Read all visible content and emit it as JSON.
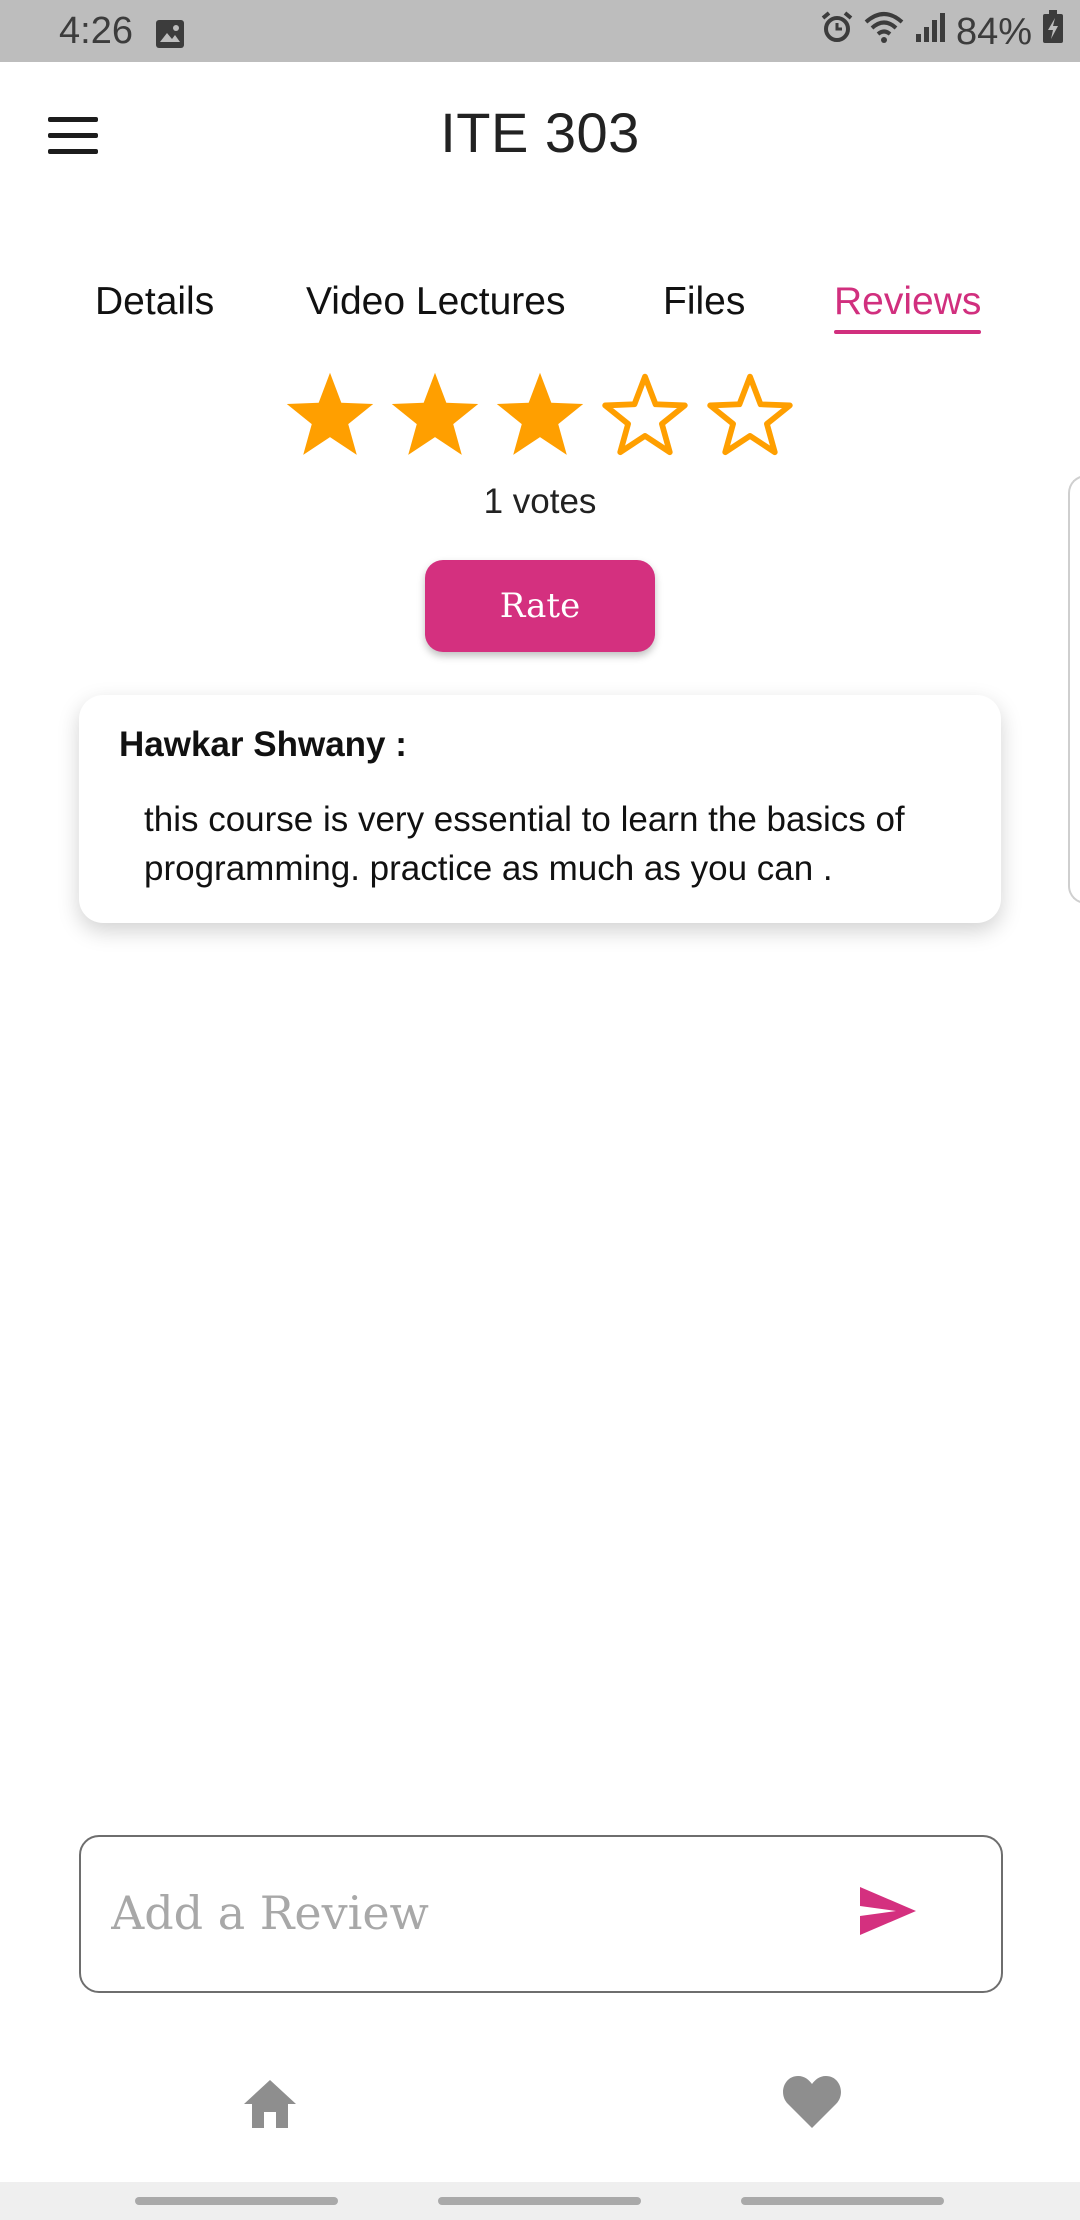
{
  "status_bar": {
    "time": "4:26",
    "battery": "84%"
  },
  "app_bar": {
    "title": "ITE 303"
  },
  "tabs": [
    {
      "label": "Details",
      "active": false
    },
    {
      "label": "Video Lectures",
      "active": false
    },
    {
      "label": "Files",
      "active": false
    },
    {
      "label": "Reviews",
      "active": true
    }
  ],
  "rating": {
    "filled_stars": 3,
    "max_stars": 5,
    "votes_label": "1 votes"
  },
  "rate_button": {
    "label": "Rate"
  },
  "reviews": [
    {
      "author": "Hawkar Shwany :",
      "text": "this course is very essential to learn the basics of programming. practice as much as you can ."
    }
  ],
  "review_input": {
    "placeholder": "Add a Review",
    "value": ""
  },
  "icons": {
    "menu": "hamburger-menu-icon",
    "send": "send-icon",
    "home": "home-icon",
    "favorite": "heart-icon",
    "star_filled": "star-filled-icon",
    "star_empty": "star-outline-icon"
  },
  "colors": {
    "accent": "#d4307f",
    "star": "#ff9f00",
    "nav_icon": "#8e8e8e"
  }
}
